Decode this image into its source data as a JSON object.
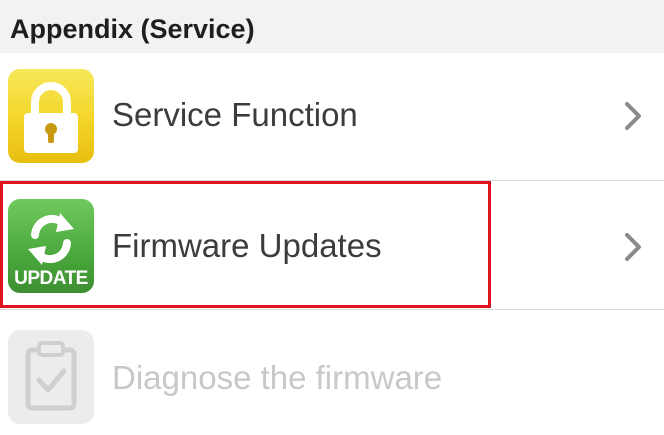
{
  "section": {
    "title": "Appendix (Service)"
  },
  "items": [
    {
      "label": "Service Function",
      "icon": "padlock-icon",
      "state": "enabled",
      "has_chevron": true
    },
    {
      "label": "Firmware Updates",
      "icon": "update-refresh-icon",
      "icon_text": "UPDATE",
      "state": "enabled",
      "has_chevron": true,
      "highlighted": true
    },
    {
      "label": "Diagnose the firmware",
      "icon": "clipboard-check-icon",
      "state": "disabled",
      "has_chevron": false
    }
  ],
  "colors": {
    "header_bg": "#f2f2f2",
    "text": "#3c3c3c",
    "disabled_text": "#c8c8c8",
    "chevron": "#8a8a8a",
    "highlight": "#e0141e",
    "lock_icon_bg": "#f3d428",
    "update_icon_bg": "#4aa83c"
  }
}
